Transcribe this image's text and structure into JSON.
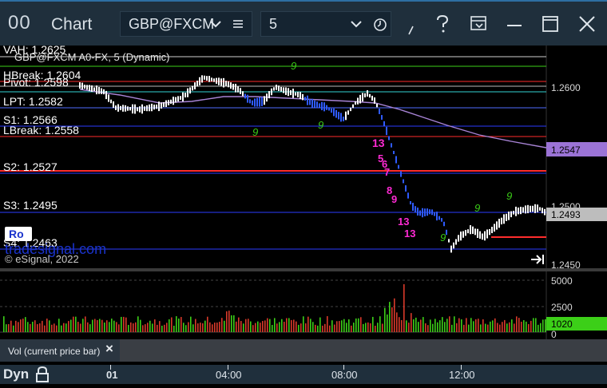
{
  "window": {
    "app_icon": "00",
    "title": "Chart",
    "symbol": "GBP@FXCM",
    "interval": "5",
    "icons": [
      "chevron-down-icon",
      "list-icon",
      "chevron-down-icon",
      "clock-icon",
      "wand-icon",
      "help-icon",
      "panel-icon",
      "minimize-icon",
      "maximize-icon",
      "close-icon"
    ]
  },
  "chart": {
    "study_title": "GBP@FXCM A0-FX, 5 (Dynamic)",
    "levels": [
      {
        "label": "VAH: 1.2625",
        "color": "#cfcfcf"
      },
      {
        "label": "HBreak: 1.2604",
        "color": "#ff2d2d"
      },
      {
        "label": "Pivot: 1.2598",
        "color": "#cfcfcf"
      },
      {
        "label": "LPT: 1.2582",
        "color": "#4f6cff"
      },
      {
        "label": "S1: 1.2566",
        "color": "#2b3dff"
      },
      {
        "label": "LBreak: 1.2558",
        "color": "#ff2d2d"
      },
      {
        "label": "S2: 1.2527",
        "color": "#ff2d2d"
      },
      {
        "label": "S3: 1.2495",
        "color": "#2b3dff"
      },
      {
        "label": "S4: 1.2463",
        "color": "#2b3dff"
      }
    ],
    "price_axis": [
      "1.2600",
      "1.2500",
      "1.2450"
    ],
    "price_badges": [
      {
        "value": "1.2547",
        "color": "#9b73d6"
      },
      {
        "value": "1.2493",
        "color": "#bdbdbd"
      }
    ],
    "volume_axis": [
      "5000",
      "2500",
      "0"
    ],
    "volume_badge": {
      "value": "1020",
      "color": "#3ccf18"
    },
    "watermark": "tradesignal.com",
    "copyright": "© eSignal, 2022",
    "go_button": "Ro",
    "setup_counts_pink": [
      "13",
      "5",
      "6",
      "7",
      "8",
      "9",
      "13",
      "13"
    ],
    "setup_counts_green": [
      "9",
      "9",
      "9",
      "9",
      "9",
      "9"
    ]
  },
  "volume_study": {
    "label": "Vol (current price bar)",
    "close": "×"
  },
  "status_bar": {
    "mode": "Dyn",
    "time_labels": [
      "01",
      "04:00",
      "08:00",
      "12:00"
    ]
  }
}
